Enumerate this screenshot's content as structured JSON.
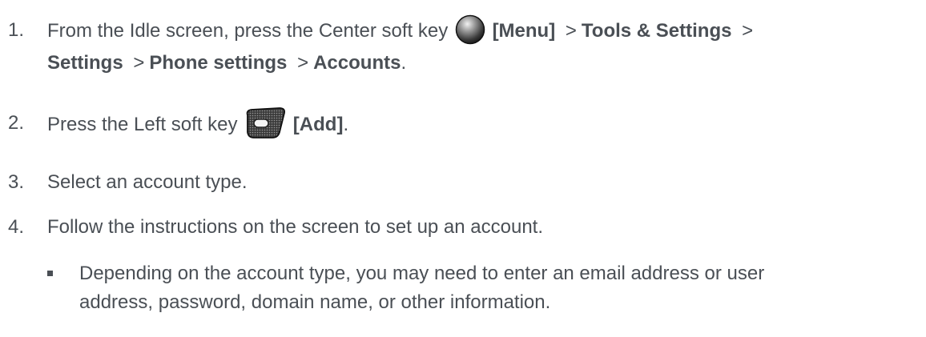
{
  "steps": [
    {
      "number": "1.",
      "line1_pre": "From the Idle screen, press the Center soft key",
      "menu_label": "[Menu]",
      "sep": ">",
      "tools": "Tools & Settings",
      "settings": "Settings",
      "phone_settings": "Phone settings",
      "accounts": "Accounts",
      "end": "."
    },
    {
      "number": "2.",
      "pre": "Press the Left soft key",
      "add_label": "[Add]",
      "end": "."
    },
    {
      "number": "3.",
      "text": "Select an account type."
    },
    {
      "number": "4.",
      "text": "Follow the instructions on the screen to set up an account."
    }
  ],
  "bullet": {
    "line1": "Depending on the account type, you may need to enter an email address or user",
    "line2": "address, password, domain name, or other information."
  },
  "icons": {
    "center_soft_key": "center-soft-key-icon",
    "left_soft_key": "left-soft-key-icon"
  }
}
